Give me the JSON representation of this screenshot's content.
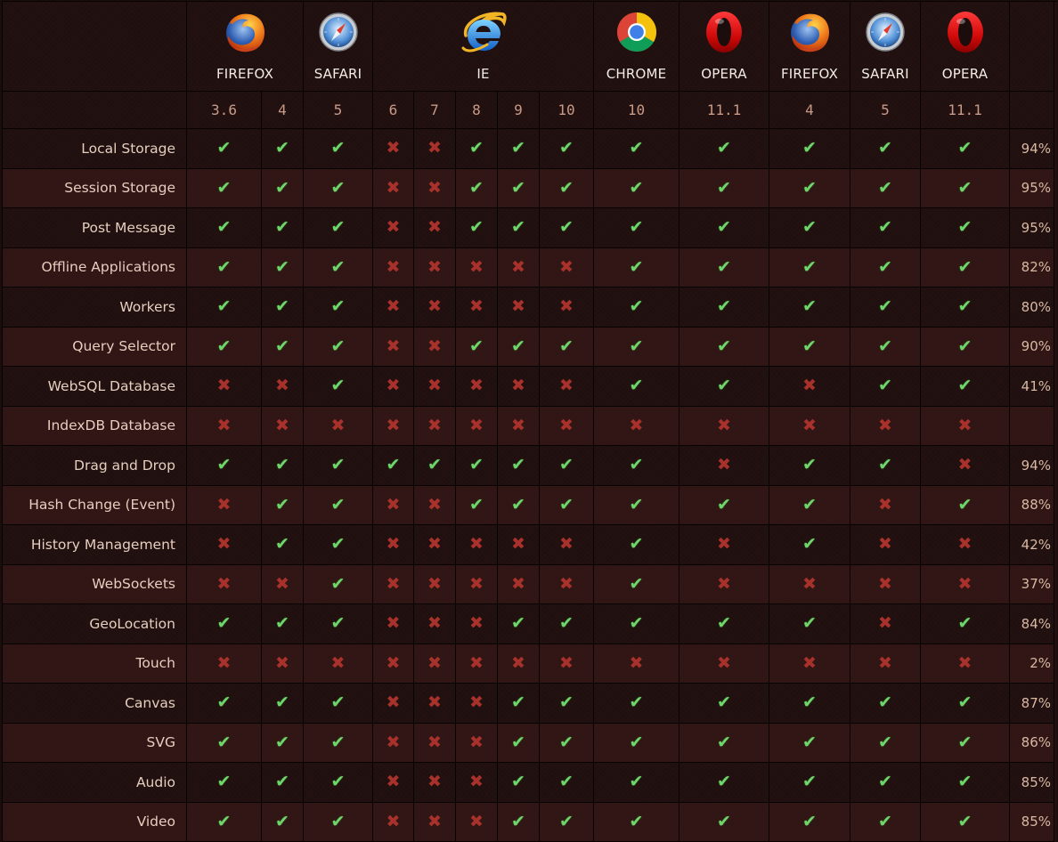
{
  "browsers": [
    {
      "name": "FIREFOX",
      "icon": "firefox-icon",
      "span": 2
    },
    {
      "name": "SAFARI",
      "icon": "safari-icon",
      "span": 1
    },
    {
      "name": "IE",
      "icon": "ie-icon",
      "span": 5
    },
    {
      "name": "CHROME",
      "icon": "chrome-icon",
      "span": 1
    },
    {
      "name": "OPERA",
      "icon": "opera-icon",
      "span": 1
    },
    {
      "name": "FIREFOX",
      "icon": "firefox-icon",
      "span": 1
    },
    {
      "name": "SAFARI",
      "icon": "safari-icon",
      "span": 1
    },
    {
      "name": "OPERA",
      "icon": "opera-icon",
      "span": 1
    }
  ],
  "versions": [
    "3.6",
    "4",
    "5",
    "6",
    "7",
    "8",
    "9",
    "10",
    "10",
    "11.1",
    "4",
    "5",
    "11.1"
  ],
  "marks": {
    "yes": "✔",
    "no": "✖"
  },
  "colors": {
    "yes": "#6ed66a",
    "no": "#a8312b",
    "background": "#1a0d0c"
  },
  "features": [
    {
      "name": "Local Storage",
      "support": "YYYNNYYYYYYYY",
      "percent": "94%"
    },
    {
      "name": "Session Storage",
      "support": "YYYNNYYYYYYYY",
      "percent": "95%"
    },
    {
      "name": "Post Message",
      "support": "YYYNNYYYYYYYY",
      "percent": "95%"
    },
    {
      "name": "Offline Applications",
      "support": "YYYNNNNNYYYYY",
      "percent": "82%"
    },
    {
      "name": "Workers",
      "support": "YYYNNNNNYYYYY",
      "percent": "80%"
    },
    {
      "name": "Query Selector",
      "support": "YYYNNYYYYYYYY",
      "percent": "90%"
    },
    {
      "name": "WebSQL Database",
      "support": "NNYNNNNNYYNYY",
      "percent": "41%"
    },
    {
      "name": "IndexDB Database",
      "support": "NNNNNNNNNNNNN",
      "percent": ""
    },
    {
      "name": "Drag and Drop",
      "support": "YYYYYYYYYNYYN",
      "percent": "94%"
    },
    {
      "name": "Hash Change (Event)",
      "support": "NYYNNYYYYYYNY",
      "percent": "88%"
    },
    {
      "name": "History Management",
      "support": "NYYNNNNNYNYNN",
      "percent": "42%"
    },
    {
      "name": "WebSockets",
      "support": "NNYNNNNNYNNNN",
      "percent": "37%"
    },
    {
      "name": "GeoLocation",
      "support": "YYYNNNYYYYYNY",
      "percent": "84%"
    },
    {
      "name": "Touch",
      "support": "NNNNNNNNNNNNN",
      "percent": "2%"
    },
    {
      "name": "Canvas",
      "support": "YYYNNNYYYYYYY",
      "percent": "87%"
    },
    {
      "name": "SVG",
      "support": "YYYNNNYYYYYYY",
      "percent": "86%"
    },
    {
      "name": "Audio",
      "support": "YYYNNNYYYYYYY",
      "percent": "85%"
    },
    {
      "name": "Video",
      "support": "YYYNNNYYYYYYY",
      "percent": "85%"
    }
  ]
}
